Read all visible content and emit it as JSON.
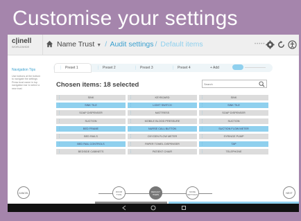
{
  "page_title": "Customise your settings",
  "header": {
    "logo_main": "c|inell",
    "logo_sub": "WORLDWIDE",
    "breadcrumb": {
      "trust": "Name Trust",
      "section": "Audit settings",
      "current": "Default items"
    },
    "status_dots": "•••••"
  },
  "sidebar": {
    "heading": "Navigation Tips",
    "text": "Use buttons at the bottom to navigate the settings Press trust name in top navigation bar to select a new trust"
  },
  "tabs": [
    {
      "label": "Preset 1"
    },
    {
      "label": "Preset 2"
    },
    {
      "label": "Preset 3"
    },
    {
      "label": "Preset 4"
    },
    {
      "label": "+ Add"
    }
  ],
  "chosen_label": "Chosen items: 18 selected",
  "search": {
    "placeholder": "Search"
  },
  "items": [
    {
      "label": "SINK",
      "selected": false
    },
    {
      "label": "SINK TILE",
      "selected": true
    },
    {
      "label": "SOAP DISPENSER",
      "selected": false
    },
    {
      "label": "SUCTION",
      "selected": false
    },
    {
      "label": "BED FRAME",
      "selected": true
    },
    {
      "label": "BED RAILS",
      "selected": false
    },
    {
      "label": "BED RAIL CONTROLS",
      "selected": true
    },
    {
      "label": "BEDSIDE CABINETS",
      "selected": false
    },
    {
      "label": "KEYBOARD",
      "selected": false
    },
    {
      "label": "LIGHT SWITCH",
      "selected": true
    },
    {
      "label": "MATTRESS",
      "selected": false
    },
    {
      "label": "MOBILE BLOOD PRESSURE",
      "selected": false
    },
    {
      "label": "NURSE CALL BUTTON",
      "selected": true
    },
    {
      "label": "OXYGEN FLOW METER",
      "selected": false
    },
    {
      "label": "PAPER TOWEL DISPENSER",
      "selected": false
    },
    {
      "label": "PATIENT CHAIR",
      "selected": false
    },
    {
      "label": "SINK",
      "selected": false
    },
    {
      "label": "SINK TILE",
      "selected": true
    },
    {
      "label": "SOAP DISPENSER",
      "selected": false
    },
    {
      "label": "SUCTION",
      "selected": false
    },
    {
      "label": "SUCTION FLOW METER",
      "selected": true
    },
    {
      "label": "SYRINGE PUMP",
      "selected": false
    },
    {
      "label": "TAP",
      "selected": true
    },
    {
      "label": "TELEPHONE",
      "selected": false
    }
  ],
  "buttons": {
    "preset_settings": "PRESET SETTINGS",
    "add_custom": "ADD CUSTOM ITEM",
    "cancel": "CANCEL",
    "next": "NEXT"
  },
  "steps": [
    {
      "label": "ROOM TYPE",
      "active": false
    },
    {
      "label": "DEFAULT ITEMS",
      "active": true
    },
    {
      "label": "MORE SETTINGS",
      "active": false
    }
  ],
  "colors": {
    "frame": "#a585ac",
    "accent_blue": "#3aa0cf",
    "selected_item": "#8fd0ee",
    "unselected_item": "#dcdcdc"
  }
}
